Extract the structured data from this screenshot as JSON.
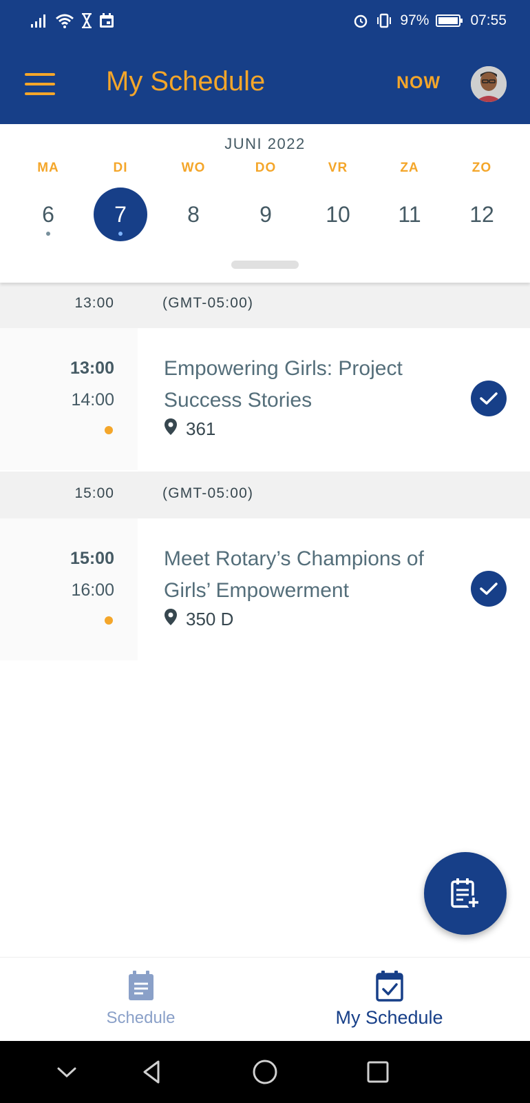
{
  "status_bar": {
    "battery": "97%",
    "time": "07:55",
    "icons_left": [
      "signal-icon",
      "wifi-icon",
      "hourglass-icon",
      "calendar-notification-icon"
    ],
    "icons_right": [
      "alarm-icon",
      "vibrate-icon",
      "battery-icon"
    ]
  },
  "app_bar": {
    "title": "My Schedule",
    "now_label": "NOW",
    "menu_icon": "hamburger-menu-icon",
    "avatar_icon": "user-avatar"
  },
  "calendar": {
    "month": "JUNI 2022",
    "days": [
      {
        "name": "MA",
        "num": "6",
        "dot": true,
        "selected": false
      },
      {
        "name": "DI",
        "num": "7",
        "dot": true,
        "selected": true
      },
      {
        "name": "WO",
        "num": "8",
        "dot": false,
        "selected": false
      },
      {
        "name": "DO",
        "num": "9",
        "dot": false,
        "selected": false
      },
      {
        "name": "VR",
        "num": "10",
        "dot": false,
        "selected": false
      },
      {
        "name": "ZA",
        "num": "11",
        "dot": false,
        "selected": false
      },
      {
        "name": "ZO",
        "num": "12",
        "dot": false,
        "selected": false
      }
    ]
  },
  "schedule": {
    "groups": [
      {
        "time": "13:00",
        "timezone": "(GMT-05:00)",
        "session": {
          "start": "13:00",
          "end": "14:00",
          "title": "Empowering Girls: Project Success Stories",
          "location": "361",
          "added": true
        }
      },
      {
        "time": "15:00",
        "timezone": "(GMT-05:00)",
        "session": {
          "start": "15:00",
          "end": "16:00",
          "title": "Meet Rotary’s Champions of Girls’ Empowerment",
          "location": "350 D",
          "added": true
        }
      }
    ]
  },
  "fab": {
    "icon": "add-to-schedule-icon"
  },
  "bottom_nav": {
    "items": [
      {
        "label": "Schedule",
        "icon": "schedule-icon",
        "active": false
      },
      {
        "label": "My Schedule",
        "icon": "my-schedule-icon",
        "active": true
      }
    ]
  },
  "colors": {
    "primary": "#173f88",
    "accent": "#f4a62a",
    "text": "#455a64",
    "inactive_nav": "#8aa0c8"
  }
}
